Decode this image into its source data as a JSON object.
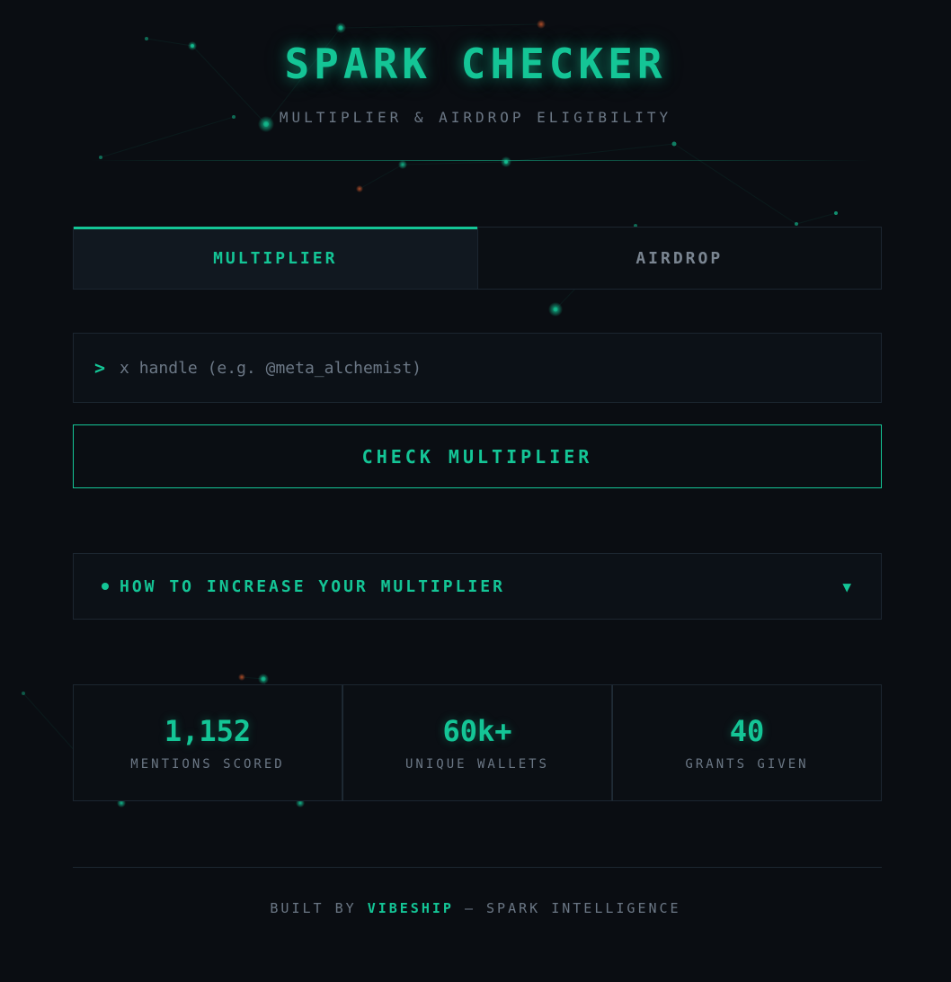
{
  "header": {
    "title": "SPARK CHECKER",
    "subtitle": "MULTIPLIER & AIRDROP ELIGIBILITY"
  },
  "tabs": [
    {
      "label": "MULTIPLIER",
      "active": true
    },
    {
      "label": "AIRDROP",
      "active": false
    }
  ],
  "input": {
    "prompt": ">",
    "value": "",
    "placeholder": "x handle (e.g. @meta_alchemist)"
  },
  "check_button": {
    "label": "CHECK MULTIPLIER"
  },
  "accordion": {
    "label": "HOW TO INCREASE YOUR MULTIPLIER",
    "expanded": false,
    "chevron": "▼"
  },
  "stats": [
    {
      "value": "1,152",
      "label": "MENTIONS SCORED"
    },
    {
      "value": "60k+",
      "label": "UNIQUE WALLETS"
    },
    {
      "value": "40",
      "label": "GRANTS GIVEN"
    }
  ],
  "footer": {
    "prefix": "BUILT BY ",
    "brand": "VIBESHIP",
    "suffix": " — SPARK INTELLIGENCE"
  },
  "colors": {
    "accent": "#14c596",
    "background": "#0a0d12",
    "muted_text": "#6b7785",
    "border": "#1c2630"
  }
}
